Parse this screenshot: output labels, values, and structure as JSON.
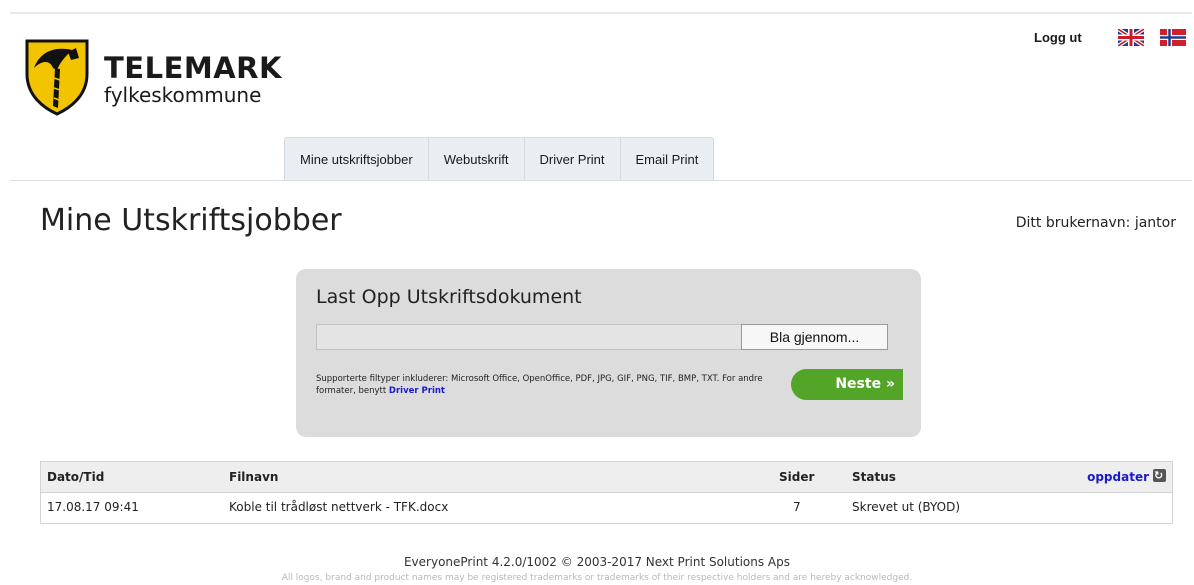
{
  "header": {
    "logo_title": "TELEMARK",
    "logo_subtitle": "fylkeskommune",
    "logout_label": "Logg ut",
    "flags": [
      "english-flag-icon",
      "norwegian-flag-icon"
    ]
  },
  "nav": {
    "tabs": [
      {
        "label": "Mine utskriftsjobber",
        "active": true
      },
      {
        "label": "Webutskrift",
        "active": false
      },
      {
        "label": "Driver Print",
        "active": false
      },
      {
        "label": "Email Print",
        "active": false
      }
    ]
  },
  "page": {
    "title": "Mine Utskriftsjobber",
    "username_text": "Ditt brukernavn: jantor"
  },
  "upload": {
    "title": "Last Opp Utskriftsdokument",
    "file_value": "",
    "browse_label": "Bla gjennom...",
    "support_text": "Supporterte filtyper inkluderer: Microsoft Office, OpenOffice, PDF, JPG, GIF, PNG, TIF, BMP, TXT. For andre formater, benytt",
    "support_link": "Driver Print",
    "next_label": "Neste »"
  },
  "jobs": {
    "columns": [
      "Dato/Tid",
      "Filnavn",
      "Sider",
      "Status"
    ],
    "refresh_label": "oppdater",
    "rows": [
      {
        "date": "17.08.17 09:41",
        "name": "Koble til trådløst nettverk - TFK.docx",
        "pages": "7",
        "status": "Skrevet ut (BYOD)"
      }
    ]
  },
  "footer": {
    "line1": "EveryonePrint 4.2.0/1002 © 2003-2017 Next Print Solutions Aps",
    "line2": "All logos, brand and product names may be registered trademarks or trademarks of their respective holders and are hereby acknowledged."
  },
  "colors": {
    "accent_green": "#52a526",
    "link_blue": "#1a1acc",
    "nav_bg": "#e8eef2",
    "upload_bg": "#dcdcdc"
  }
}
